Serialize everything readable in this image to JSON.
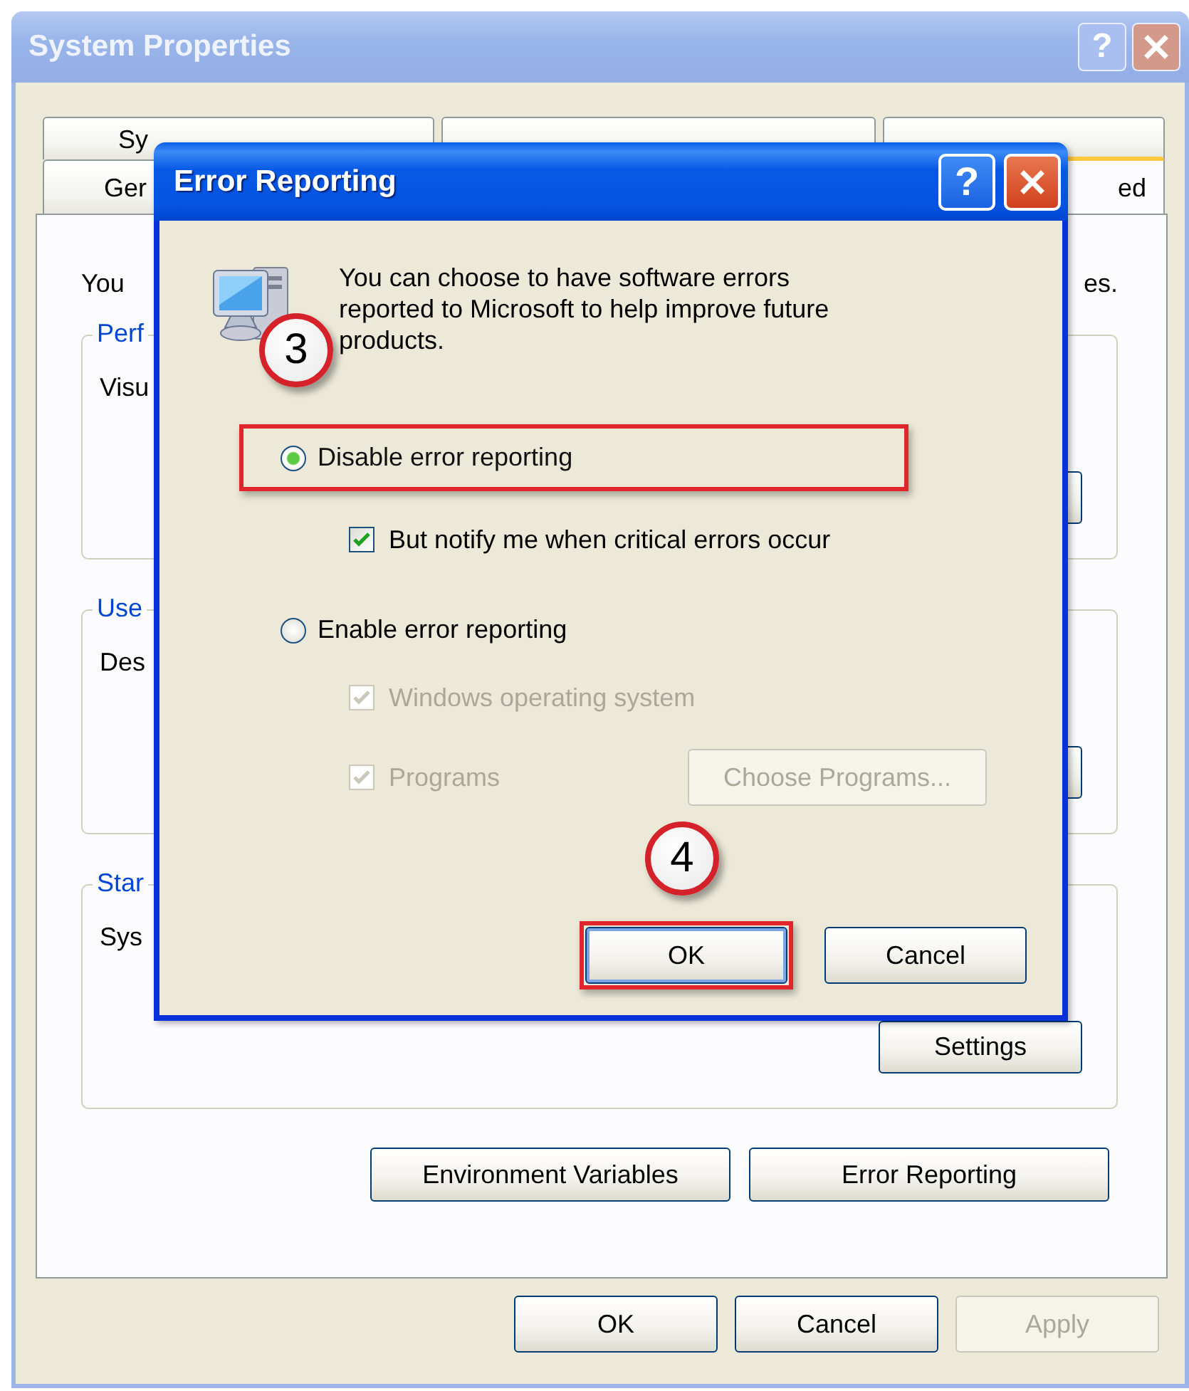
{
  "window": {
    "title": "System Properties",
    "help": "?"
  },
  "tab_rows": [
    [
      {
        "label": "Sy",
        "selected": false
      },
      {
        "selected": false
      },
      {
        "selected": false
      }
    ],
    [
      {
        "label": "Ger",
        "selected": false
      },
      {
        "label": "ed",
        "selected": true
      }
    ]
  ],
  "intro": {
    "start": "You",
    "end": "es."
  },
  "groups": [
    {
      "title": "Perf",
      "text": "Visu",
      "button": {
        "kind": "push"
      }
    },
    {
      "title": "Use",
      "text": "Des",
      "button": {
        "kind": "push"
      }
    },
    {
      "title": "Star",
      "text": "Sys",
      "button": {
        "kind": "push",
        "label": "Settings"
      }
    }
  ],
  "panel_buttons": [
    "Environment Variables",
    "Error Reporting"
  ],
  "footer_buttons": [
    {
      "label": "OK",
      "disabled": false
    },
    {
      "label": "Cancel",
      "disabled": false
    },
    {
      "label": "Apply",
      "disabled": true
    }
  ],
  "dialog": {
    "title": "Error Reporting",
    "help": "?",
    "message": "You can choose to have software errors\nreported to Microsoft to help improve future\nproducts.",
    "options": [
      {
        "kind": "radio",
        "label": "Disable error reporting",
        "selected": true,
        "highlighted": true,
        "step": "3",
        "children": [
          {
            "kind": "checkbox",
            "label": "But notify me when critical errors occur",
            "checked": true,
            "disabled": false
          }
        ]
      },
      {
        "kind": "radio",
        "label": "Enable error reporting",
        "selected": false,
        "highlighted": false,
        "children": [
          {
            "kind": "checkbox",
            "label": "Windows operating system",
            "checked": true,
            "disabled": true
          },
          {
            "kind": "checkbox",
            "label": "Programs",
            "checked": true,
            "disabled": true,
            "button": {
              "label": "Choose Programs...",
              "disabled": true
            }
          }
        ]
      }
    ],
    "buttons": [
      {
        "label": "OK",
        "highlighted": true,
        "step": "4"
      },
      {
        "label": "Cancel",
        "highlighted": false
      }
    ]
  }
}
